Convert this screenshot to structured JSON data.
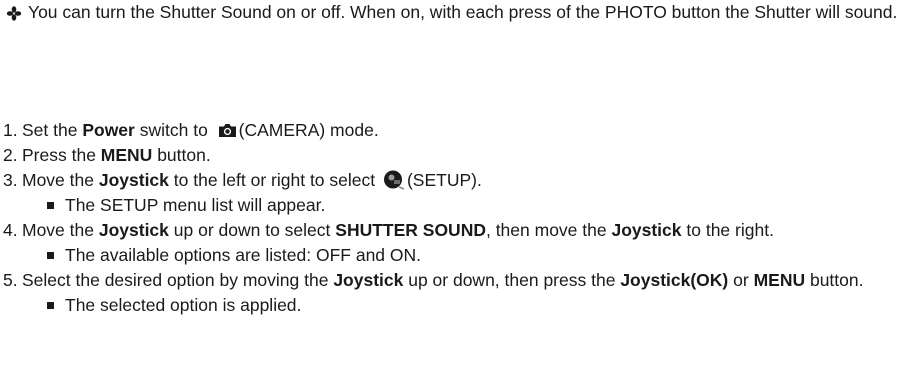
{
  "intro": {
    "bullet_icon": "four-petal-diamond-icon",
    "text": "You can turn the Shutter Sound on or off. When on, with each press of the PHOTO button the Shutter will sound."
  },
  "steps": [
    {
      "number": "1.",
      "parts": [
        "Set the ",
        "Power",
        " switch to ",
        "(CAMERA) mode."
      ],
      "icon": "camera-icon"
    },
    {
      "number": "2.",
      "parts": [
        "Press the ",
        "MENU",
        " button."
      ]
    },
    {
      "number": "3.",
      "parts": [
        "Move the ",
        "Joystick",
        " to the left or right to select ",
        "(SETUP)."
      ],
      "icon": "setup-icon",
      "sub": "The SETUP menu list will appear."
    },
    {
      "number": "4.",
      "parts": [
        "Move the ",
        "Joystick",
        " up or down to select ",
        "SHUTTER SOUND",
        ", then move the ",
        "Joystick",
        " to the right."
      ],
      "sub": "The available options are listed: OFF and ON."
    },
    {
      "number": "5.",
      "parts": [
        "Select the desired option by moving the ",
        "Joystick",
        " up or down, then press the ",
        "Joystick(OK)",
        " or ",
        "MENU",
        " button."
      ],
      "sub": "The selected option is applied."
    }
  ],
  "colors": {
    "text": "#1a1a1a",
    "background": "#ffffff"
  }
}
